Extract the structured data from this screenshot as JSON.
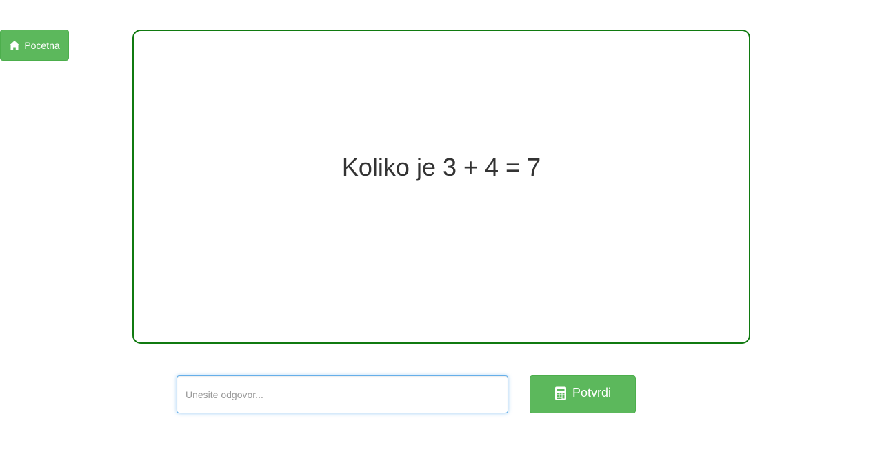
{
  "nav": {
    "home_label": "Pocetna",
    "home_icon": "home-icon"
  },
  "question": {
    "text": "Koliko je 3 + 4 = 7"
  },
  "answer": {
    "placeholder": "Unesite odgovor...",
    "value": ""
  },
  "submit": {
    "label": "Potvrdi",
    "icon": "calculator-icon"
  },
  "colors": {
    "button_green": "#5cb85c",
    "box_border": "#107a10",
    "focus_blue": "#66afe9"
  }
}
